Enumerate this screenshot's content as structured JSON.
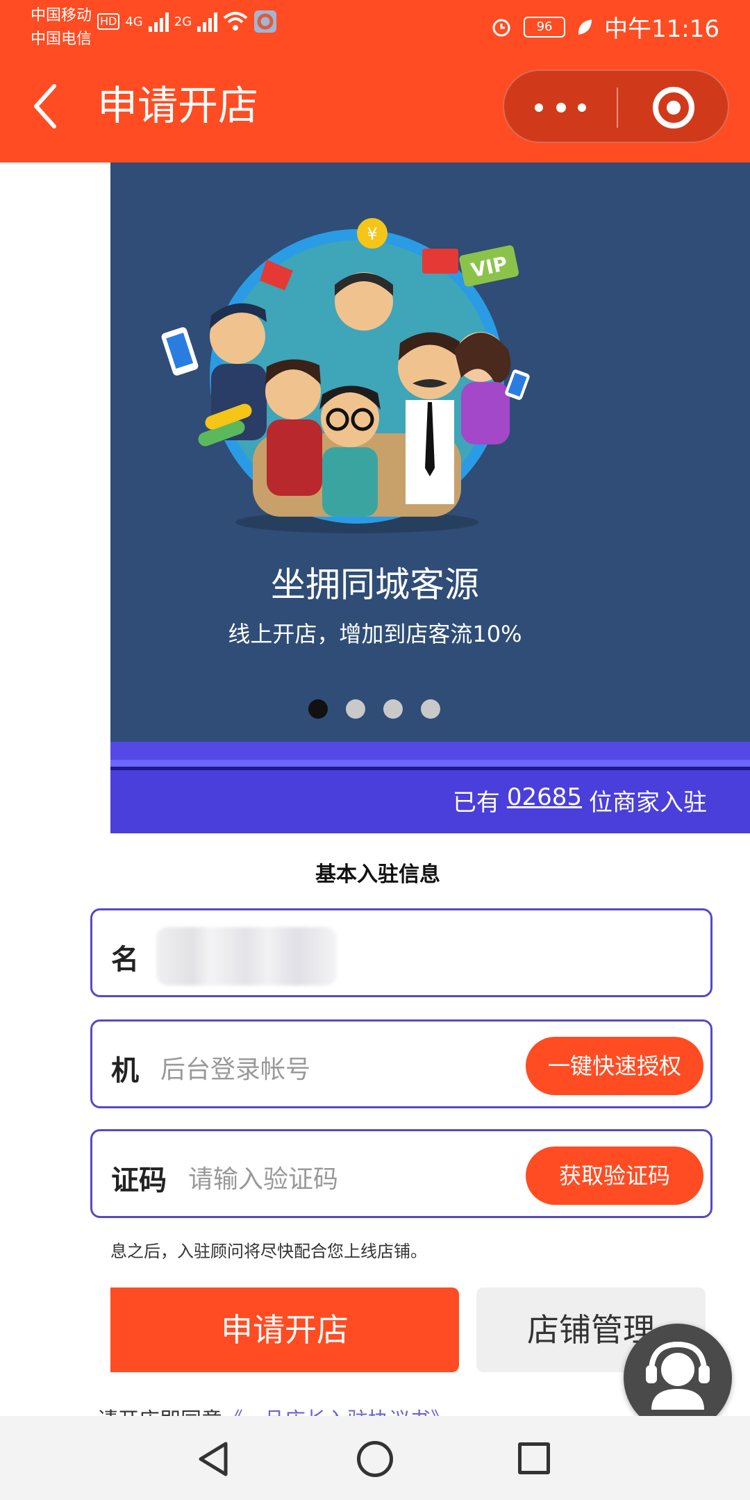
{
  "status_bar": {
    "carrier1": "中国移动",
    "carrier2": "中国电信",
    "hd": "HD",
    "net1": "4G",
    "net2": "2G",
    "battery": "96",
    "time": "中午11:16"
  },
  "header": {
    "title": "申请开店"
  },
  "banner": {
    "title": "坐拥同城客源",
    "subtitle": "线上开店，增加到店客流10%",
    "vip_text": "VIP",
    "yen": "¥",
    "page_count": 4,
    "active_page": 1
  },
  "merchant": {
    "prefix": "已有",
    "count": "02685",
    "suffix": "位商家入驻"
  },
  "form": {
    "section_title": "基本入驻信息",
    "name_label": "名",
    "name_value": "",
    "phone_label": "机",
    "phone_placeholder": "后台登录帐号",
    "phone_button": "一键快速授权",
    "code_label": "证码",
    "code_placeholder": "请输入验证码",
    "code_button": "获取验证码",
    "hint": "息之后，入驻顾问将尽快配合您上线店铺。"
  },
  "actions": {
    "apply": "申请开店",
    "manage": "店铺管理"
  },
  "agreement": {
    "text": "请开店即同意",
    "link": "《一品店长入驻协议书》"
  },
  "colors": {
    "brand": "#ff4c22",
    "banner_bg": "#2f4d76",
    "strip": "#4a3fdb",
    "field_border": "#5748c8"
  },
  "icons": {
    "back": "chevron-left-icon",
    "more": "more-dots-icon",
    "close": "target-circle-icon",
    "customer_service": "headset-agent-icon",
    "nav_back": "triangle-back-icon",
    "nav_home": "circle-home-icon",
    "nav_recent": "square-recent-icon"
  }
}
